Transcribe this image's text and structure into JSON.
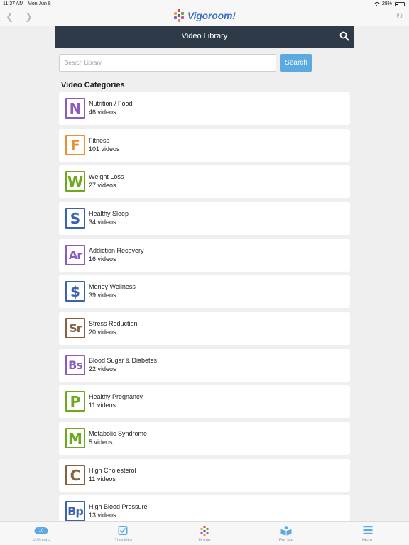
{
  "status_bar": {
    "time": "11:37 AM",
    "date": "Mon Jun 8",
    "battery": "28%"
  },
  "browser": {
    "logo_text": "Vigoroom!"
  },
  "header": {
    "title": "Video Library"
  },
  "search": {
    "placeholder": "Search Library",
    "button_label": "Search"
  },
  "section_title": "Video Categories",
  "categories": [
    {
      "letter": "N",
      "name": "Nutrition / Food",
      "count": "46 videos",
      "color": "#8a5cc0"
    },
    {
      "letter": "F",
      "name": "Fitness",
      "count": "101 videos",
      "color": "#ec8f2e"
    },
    {
      "letter": "W",
      "name": "Weight Loss",
      "count": "27 videos",
      "color": "#6ea81d"
    },
    {
      "letter": "S",
      "name": "Healthy Sleep",
      "count": "34 videos",
      "color": "#3b62b0"
    },
    {
      "letter": "Ar",
      "name": "Addiction Recovery",
      "count": "16 videos",
      "color": "#8a5cc0"
    },
    {
      "letter": "$",
      "name": "Money Wellness",
      "count": "39 videos",
      "color": "#3b62b0"
    },
    {
      "letter": "Sr",
      "name": "Stress Reduction",
      "count": "20 videos",
      "color": "#8a6140"
    },
    {
      "letter": "Bs",
      "name": "Blood Sugar & Diabetes",
      "count": "22 videos",
      "color": "#8a5cc0"
    },
    {
      "letter": "P",
      "name": "Healthy Pregnancy",
      "count": "11 videos",
      "color": "#6ea81d"
    },
    {
      "letter": "M",
      "name": "Metabolic Syndrome",
      "count": "5 videos",
      "color": "#6ea81d"
    },
    {
      "letter": "C",
      "name": "High Cholesterol",
      "count": "11 videos",
      "color": "#8a6140"
    },
    {
      "letter": "Bp",
      "name": "High Blood Pressure",
      "count": "13 videos",
      "color": "#3b62b0"
    }
  ],
  "tabbar": {
    "vpoints_value": "10",
    "tabs": [
      {
        "label": "V-Points"
      },
      {
        "label": "Checklist"
      },
      {
        "label": "Home"
      },
      {
        "label": "For Me"
      },
      {
        "label": "Menu"
      }
    ]
  },
  "colors": {
    "header_bg": "#2e3a47",
    "accent": "#5ba9e0",
    "tab_icon": "#5ba9e0"
  }
}
